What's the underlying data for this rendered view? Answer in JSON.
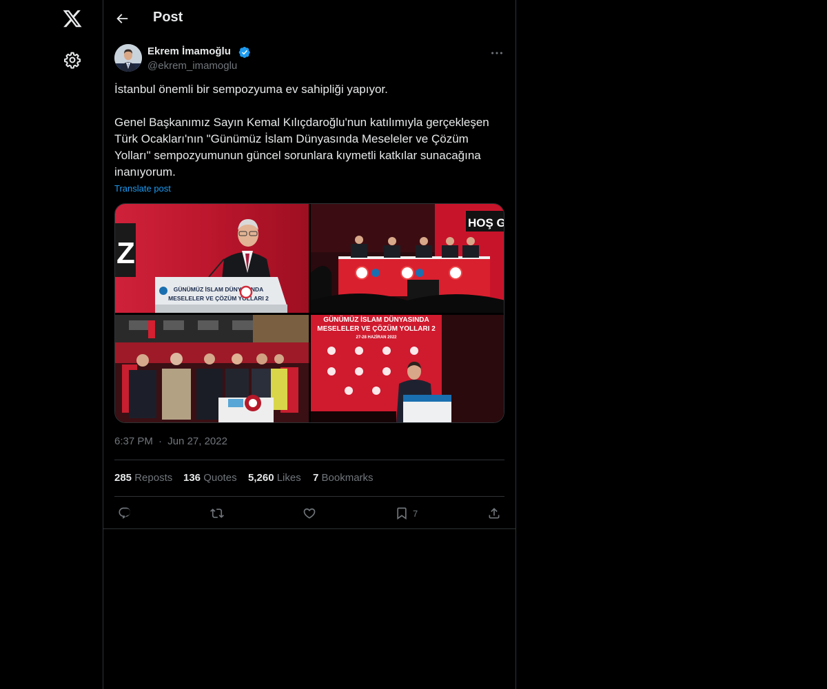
{
  "header": {
    "title": "Post"
  },
  "author": {
    "name": "Ekrem İmamoğlu",
    "handle": "@ekrem_imamoglu"
  },
  "post": {
    "paragraph1": "İstanbul önemli bir sempozyuma ev sahipliği yapıyor.",
    "paragraph2": "Genel Başkanımız Sayın Kemal Kılıçdaroğlu'nun katılımıyla gerçekleşen Türk Ocakları'nın \"Günümüz İslam Dünyasında Meseleler ve Çözüm Yolları\" sempozyumunun güncel sorunlara kıymetli katkılar sunacağına inanıyorum.",
    "translate_label": "Translate post",
    "time": "6:37 PM",
    "separator": "·",
    "date": "Jun 27, 2022"
  },
  "media": {
    "photo1": {
      "banner_line1": "GÜNÜMÜZ İSLAM DÜNYASINDA",
      "banner_line2": "MESELELER VE ÇÖZÜM YOLLARI 2",
      "side_letter": "Z"
    },
    "photo2": {
      "sign_text": "HOŞ GE"
    },
    "photo4": {
      "banner_line1": "GÜNÜMÜZ İSLAM DÜNYASINDA",
      "banner_line2": "MESELELER VE ÇÖZÜM YOLLARI 2",
      "date_text": "27-28 HAZİRAN 2022"
    }
  },
  "stats": {
    "reposts": {
      "value": "285",
      "label": "Reposts"
    },
    "quotes": {
      "value": "136",
      "label": "Quotes"
    },
    "likes": {
      "value": "5,260",
      "label": "Likes"
    },
    "bookmarks": {
      "value": "7",
      "label": "Bookmarks"
    }
  },
  "actions": {
    "bookmark_count": "7"
  },
  "colors": {
    "background": "#000000",
    "text": "#e7e9ea",
    "muted": "#71767b",
    "link": "#1d9bf0",
    "border": "#2f3336"
  },
  "icons": [
    "x-logo-icon",
    "gear-icon",
    "back-arrow-icon",
    "verified-badge-icon",
    "more-options-icon",
    "reply-icon",
    "repost-icon",
    "like-icon",
    "bookmark-icon",
    "share-icon"
  ]
}
